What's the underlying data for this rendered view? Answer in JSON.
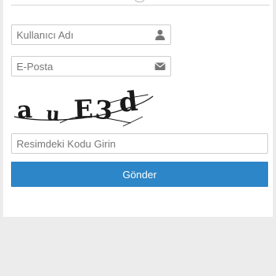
{
  "form": {
    "username": {
      "placeholder": "Kullanıcı Adı",
      "value": "",
      "icon": "user-icon"
    },
    "email": {
      "placeholder": "E-Posta",
      "value": "",
      "icon": "envelope-icon"
    },
    "captcha": {
      "text": "auE3d"
    },
    "captcha_input": {
      "placeholder": "Resimdeki Kodu Girin",
      "value": ""
    },
    "submit_label": "Gönder"
  },
  "colors": {
    "button": "#2d86c7",
    "background": "#ececec",
    "card": "#ffffff",
    "field_border": "#cfcfcf"
  }
}
